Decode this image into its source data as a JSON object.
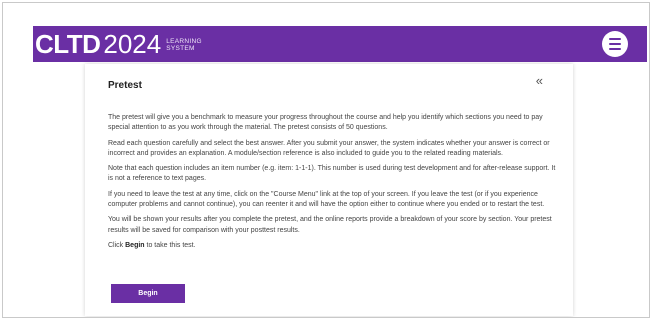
{
  "header": {
    "brand": "CLTD",
    "year": "2024",
    "subtitle_line1": "LEARNING",
    "subtitle_line2": "SYSTEM",
    "menu_icon": "hamburger-menu-icon"
  },
  "page": {
    "title": "Pretest",
    "collapse_glyph": "«",
    "paragraphs": [
      "The pretest will give you a benchmark to measure your progress throughout the course and help you identify which sections you need to pay special attention to as you work through the material. The pretest consists of 50 questions.",
      "Read each question carefully and select the best answer. After you submit your answer, the system indicates whether your answer is correct or incorrect and provides an explanation. A module/section reference is also included to guide you to the related reading materials.",
      "Note that each question includes an item number (e.g. item: 1-1-1). This number is used during test development and for after-release support. It is not a reference to text pages.",
      "If you need to leave the test at any time, click on the \"Course Menu\" link at the top of your screen. If you leave the test (or if you experience computer problems and cannot continue), you can reenter it and will have the option either to continue where you ended or to restart the test.",
      "You will be shown your results after you complete the pretest, and the online reports provide a breakdown of your score by section. Your pretest results will be saved for comparison with your posttest results."
    ],
    "instruction_prefix": "Click ",
    "instruction_bold": "Begin",
    "instruction_suffix": " to take this test.",
    "begin_label": "Begin"
  },
  "colors": {
    "brand_purple": "#6a2fa4",
    "text": "#444444"
  }
}
